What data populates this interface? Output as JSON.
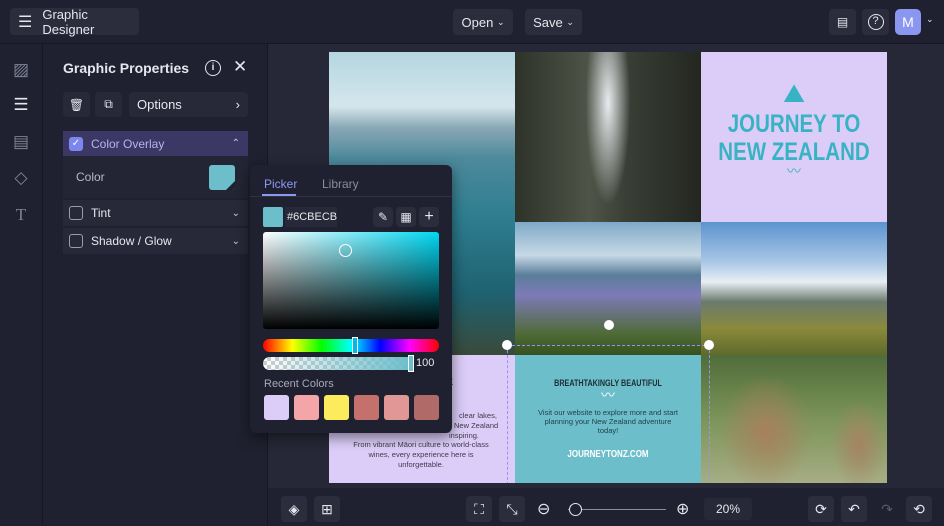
{
  "app": {
    "title": "Graphic Designer",
    "menu_icon": "hamburger-icon"
  },
  "topbar": {
    "open_label": "Open",
    "save_label": "Save",
    "avatar_letter": "M"
  },
  "panel": {
    "title": "Graphic Properties",
    "options_label": "Options",
    "color_overlay_label": "Color Overlay",
    "color_label": "Color",
    "tint_label": "Tint",
    "shadow_label": "Shadow / Glow",
    "overlay_color": "#6CBECB"
  },
  "picker": {
    "tabs": [
      "Picker",
      "Library"
    ],
    "hex": "#6CBECB",
    "opacity": "100",
    "hue_fraction": 0.52,
    "recent_label": "Recent Colors",
    "recent_colors": [
      "#dccdf8",
      "#f4a5a8",
      "#fcec5d",
      "#c4706c",
      "#e09796",
      "#b06b68"
    ]
  },
  "design": {
    "title_line1": "JOURNEY TO",
    "title_line2": "NEW ZEALAND",
    "teal_heading": "BREATHTAKINGLY BEAUTIFUL",
    "teal_body": "Visit our website to explore more and start planning your New Zealand adventure today!",
    "teal_url": "JOURNEYTONZ.COM",
    "purple_heading_fragment": "E",
    "purple_body_fragments": [
      "clear lakes,",
      "New Zealand",
      "inspiring."
    ],
    "purple_body_visible": "From vibrant Māori culture to world-class wines, every experience here is unforgettable.",
    "accent_purple": "#dccdf8",
    "accent_teal": "#6cbecb"
  },
  "bottom": {
    "zoom": "20%",
    "zoom_fraction": 0.05
  }
}
